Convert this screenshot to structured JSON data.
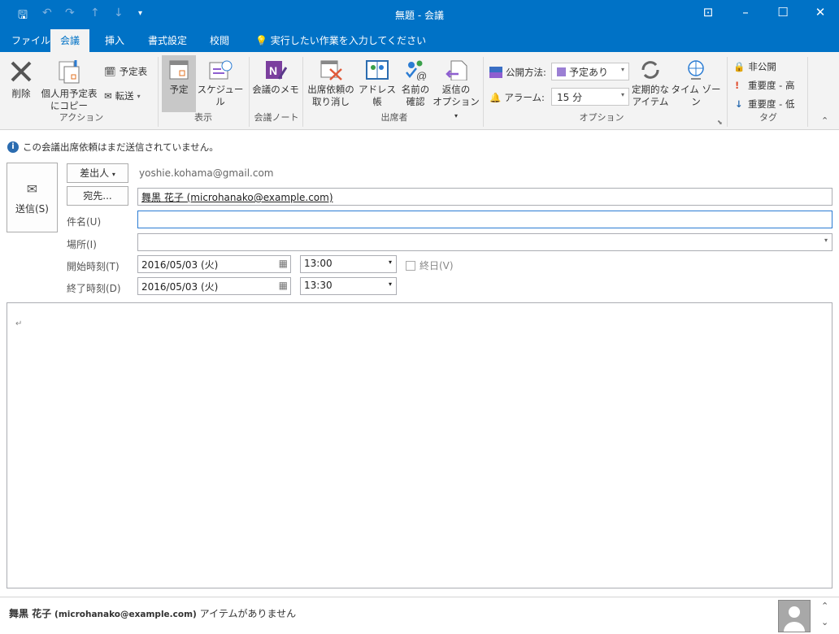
{
  "window": {
    "title": "無題 - 会議"
  },
  "tabs": [
    "ファイル",
    "会議",
    "挿入",
    "書式設定",
    "校閲"
  ],
  "tell_me": "実行したい作業を入力してください",
  "ribbon": {
    "actions": {
      "delete": "削除",
      "copy_line1": "個人用予定表",
      "copy_line2": "にコピー",
      "calendar": "予定表",
      "forward": "転送",
      "group": "アクション"
    },
    "show": {
      "appointment": "予定",
      "schedule": "スケジュール",
      "group": "表示"
    },
    "notes": {
      "meeting_notes": "会議のメモ",
      "group": "会議ノート"
    },
    "attendees": {
      "cancel_line1": "出席依頼の",
      "cancel_line2": "取り消し",
      "address_book": "アドレス帳",
      "check_line1": "名前の",
      "check_line2": "確認",
      "reply_line1": "返信の",
      "reply_line2": "オプション",
      "group": "出席者"
    },
    "options": {
      "show_as_label": "公開方法:",
      "show_as_value": "予定あり",
      "reminder_label": "アラーム:",
      "reminder_value": "15 分",
      "recurrence_line1": "定期的な",
      "recurrence_line2": "アイテム",
      "time_zone": "タイム ゾーン",
      "group": "オプション"
    },
    "tags": {
      "private": "非公開",
      "high": "重要度 - 高",
      "low": "重要度 - 低",
      "group": "タグ"
    }
  },
  "info_bar": "この会議出席依頼はまだ送信されていません。",
  "form": {
    "send": "送信(S)",
    "from_button": "差出人",
    "from_value": "yoshie.kohama@gmail.com",
    "to_button": "宛先...",
    "to_value": "舞黒 花子 (microhanako@example.com)",
    "subject_label": "件名(U)",
    "subject_value": "",
    "location_label": "場所(I)",
    "location_value": "",
    "start_label": "開始時刻(T)",
    "start_date": "2016/05/03 (火)",
    "start_time": "13:00",
    "all_day": "終日(V)",
    "end_label": "終了時刻(D)",
    "end_date": "2016/05/03 (火)",
    "end_time": "13:30",
    "body_mark": "↵"
  },
  "footer": {
    "name": "舞黒 花子",
    "email": "(microhanako@example.com)",
    "status": "アイテムがありません"
  },
  "colors": {
    "accent": "#0072c6",
    "show_as": "#9b7fd4"
  }
}
